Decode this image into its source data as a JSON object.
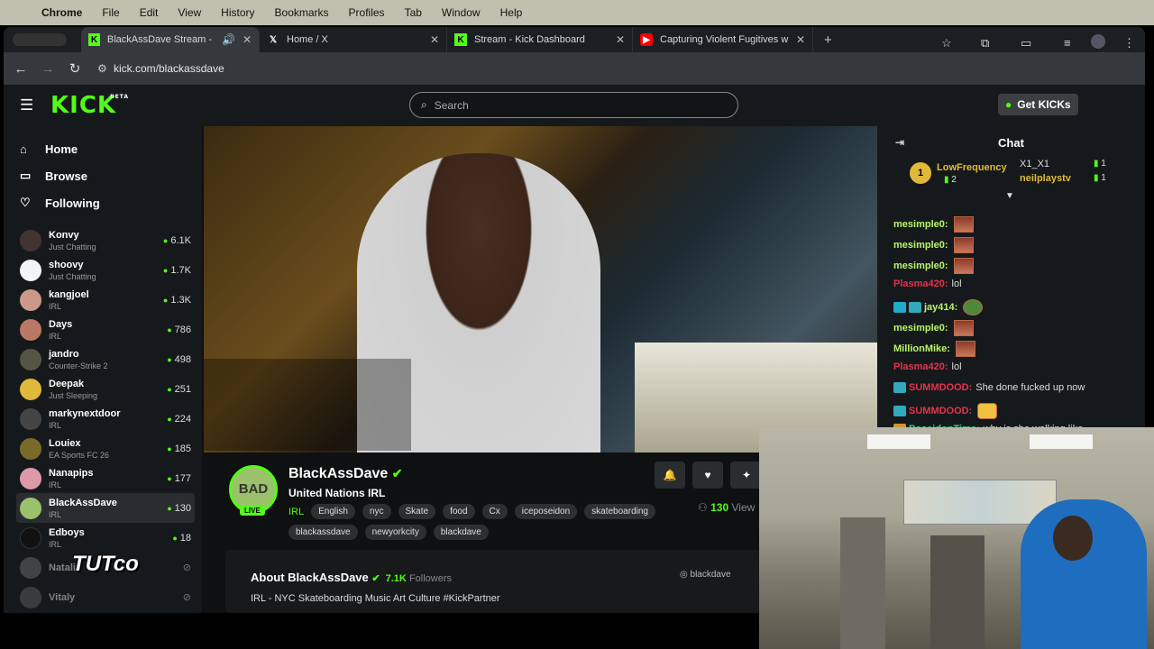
{
  "menubar": {
    "app": "Chrome",
    "items": [
      "File",
      "Edit",
      "View",
      "History",
      "Bookmarks",
      "Profiles",
      "Tab",
      "Window",
      "Help"
    ]
  },
  "tabs": [
    {
      "title": "BlackAssDave Stream - W",
      "icon": "kick-icon",
      "active": true
    },
    {
      "title": "Home / X",
      "icon": "x-icon"
    },
    {
      "title": "Stream - Kick Dashboard",
      "icon": "kick-icon"
    },
    {
      "title": "Capturing Violent Fugitives w",
      "icon": "youtube-icon"
    }
  ],
  "address": {
    "url": "kick.com/blackassdave"
  },
  "kick": {
    "logo": "KICK",
    "logo_sup": "BETA",
    "search_placeholder": "Search",
    "get_kicks": "Get KICKs"
  },
  "sidebar": {
    "nav": [
      {
        "label": "Home",
        "icon": "home-icon"
      },
      {
        "label": "Browse",
        "icon": "browse-icon"
      },
      {
        "label": "Following",
        "icon": "heart-icon"
      }
    ],
    "channels": [
      {
        "name": "Konvy",
        "game": "Just Chatting",
        "viewers": "6.1K"
      },
      {
        "name": "shoovy",
        "game": "Just Chatting",
        "viewers": "1.7K"
      },
      {
        "name": "kangjoel",
        "game": "IRL",
        "viewers": "1.3K"
      },
      {
        "name": "Days",
        "game": "IRL",
        "viewers": "786"
      },
      {
        "name": "jandro",
        "game": "Counter-Strike 2",
        "viewers": "498"
      },
      {
        "name": "Deepak",
        "game": "Just Sleeping",
        "viewers": "251"
      },
      {
        "name": "markynextdoor",
        "game": "IRL",
        "viewers": "224"
      },
      {
        "name": "Louiex",
        "game": "EA Sports FC 26",
        "viewers": "185"
      },
      {
        "name": "Nanapips",
        "game": "IRL",
        "viewers": "177"
      },
      {
        "name": "BlackAssDave",
        "game": "IRL",
        "viewers": "130"
      },
      {
        "name": "Edboys",
        "game": "IRL",
        "viewers": "18"
      },
      {
        "name": "Natalie",
        "game": "",
        "viewers": ""
      },
      {
        "name": "Vitaly",
        "game": "",
        "viewers": ""
      }
    ]
  },
  "stream": {
    "name": "BlackAssDave",
    "avatar_text": "BAD",
    "live": "LIVE",
    "title": "United Nations IRL",
    "category": "IRL",
    "tags": [
      "English",
      "nyc",
      "Skate",
      "food",
      "Cx",
      "iceposeidon",
      "skateboarding",
      "blackassdave",
      "newyorkcity",
      "blackdave"
    ],
    "viewers": "130",
    "viewers_label": "View"
  },
  "about": {
    "heading": "About BlackAssDave",
    "followers": "7.1K",
    "followers_label": "Followers",
    "description": "IRL - NYC Skateboarding Music Art Culture #KickPartner",
    "instagram": "blackdave"
  },
  "chat": {
    "title": "Chat",
    "leaderboard": [
      {
        "name": "LowFrequency",
        "count": "2"
      },
      {
        "name": "X1_X1",
        "count": "1"
      },
      {
        "name": "neilplaystv",
        "count": "1"
      }
    ],
    "messages": [
      {
        "user": "mesimple0:",
        "text": "",
        "color": "#b8f56b",
        "emote": true
      },
      {
        "user": "mesimple0:",
        "text": "",
        "color": "#b8f56b",
        "emote": true
      },
      {
        "user": "mesimple0:",
        "text": "",
        "color": "#b8f56b",
        "emote": true
      },
      {
        "user": "Plasma420:",
        "text": "lol",
        "color": "#e5334d"
      },
      {
        "user": "jay414:",
        "text": "",
        "color": "#b8f56b",
        "emote": true
      },
      {
        "user": "mesimple0:",
        "text": "",
        "color": "#b8f56b",
        "emote": true
      },
      {
        "user": "MillionMike:",
        "text": "",
        "color": "#b8f56b",
        "emote": true
      },
      {
        "user": "Plasma420:",
        "text": "lol",
        "color": "#e5334d"
      },
      {
        "user": "SUMMDOOD:",
        "text": "She done fucked up now",
        "color": "#e5334d"
      },
      {
        "user": "SUMMDOOD:",
        "text": "",
        "color": "#e5334d",
        "emote": true
      },
      {
        "user": "PoseidonTime:",
        "text": "why is she walking like",
        "color": "#3ad47f"
      }
    ]
  },
  "watermark": "TUTco"
}
